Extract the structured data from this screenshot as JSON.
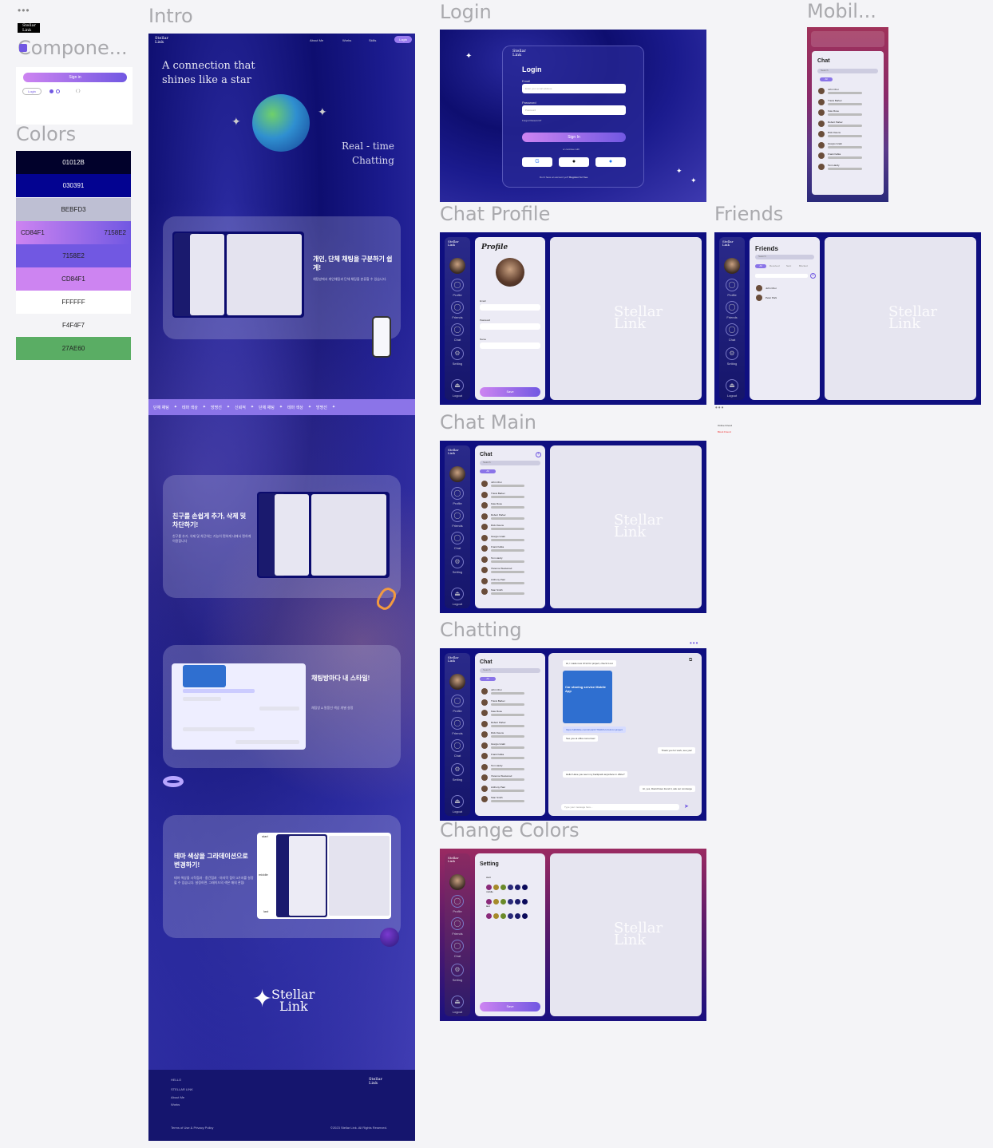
{
  "canvas": {
    "top_dots": "•••",
    "sections": {
      "components": "Compone...",
      "colors": "Colors",
      "intro": "Intro",
      "login": "Login",
      "mobile": "Mobil...",
      "chat_profile": "Chat Profile",
      "friends": "Friends",
      "chat_main": "Chat Main",
      "chatting": "Chatting",
      "change_colors": "Change Colors"
    }
  },
  "brand": {
    "line1": "Stellar",
    "line2": "Link"
  },
  "components": {
    "signin": "Sign in",
    "login_tag": "Login",
    "arrows": "〈 〉"
  },
  "colors": [
    {
      "hex": "01012B",
      "fg": "#ffffff",
      "bg": "#01012b"
    },
    {
      "hex": "030391",
      "fg": "#ffffff",
      "bg": "#030391"
    },
    {
      "hex": "BEBFD3",
      "fg": "#222222",
      "bg": "#bebfd3"
    },
    {
      "hex": "7158E2",
      "fg": "#222222",
      "bg": "#7158e2"
    },
    {
      "hex": "CD84F1",
      "fg": "#222222",
      "bg": "#cd84f1"
    },
    {
      "hex": "FFFFFF",
      "fg": "#222222",
      "bg": "#ffffff"
    },
    {
      "hex": "F4F4F7",
      "fg": "#222222",
      "bg": "#f4f4f7"
    },
    {
      "hex": "27AE60",
      "fg": "#222222",
      "bg": "#5aad64"
    }
  ],
  "gradient_swatch": {
    "left": "CD84F1",
    "right": "7158E2"
  },
  "intro": {
    "nav": [
      "About Me",
      "Works",
      "Skills"
    ],
    "nav_button": "Login",
    "headline1": "A connection that",
    "headline2": "shines like a star",
    "realtime1": "Real - time",
    "realtime2": "Chatting",
    "feat1_title": "개인, 단체 채팅을 구분하기 쉽게!",
    "feat1_desc": "채팅방에서 개인채팅과 단체 채팅을 분류할 수 있습니다.",
    "marquee": [
      "단체 채팅",
      "테마 색상",
      "방명선",
      "신뢰적",
      "단체 채팅",
      "테마 색상",
      "방명선"
    ],
    "feat2_title": "친구를 손쉽게 추가, 삭제 및 차단하기!",
    "feat2_desc": "친구를 추가, 삭제 및 차단하는 기능이 편하게 내에서 편하게 이용합니다",
    "feat3_title": "채팅방마다 내 스타일!",
    "feat3_desc": "채팅방 & 말풍선 색상 개별 설정",
    "feat4_title": "테마 색상을 그라데이션으로 변경하기!",
    "feat4_desc": "테마 색상을 시작점과 · 중간점과 · 마지막 점이 3가지를 설정할 수 있습니다. 설정하면, 그래이드의 색은 매의 관점!",
    "grad_labels": [
      "start",
      "middle",
      "last"
    ],
    "footer_links": [
      "HELLO",
      "STELLAR LINK",
      "About Me",
      "Works"
    ],
    "footer_terms": "Terms of Use & Privacy Policy",
    "footer_copy": "©2023 Stellar Link. All Rights Reserved."
  },
  "login": {
    "title": "Login",
    "email": "Email",
    "email_ph": "Enter your email address",
    "password": "Password",
    "password_ph": "Password",
    "forgot": "Forgot Password?",
    "signin": "Sign In",
    "or": "or continue with",
    "noacc": "Don't have an account yet?",
    "register": "Register for free"
  },
  "mobile": {
    "title": "Chat",
    "search": "Search",
    "tabs": [
      "All",
      "Team",
      "Friends"
    ]
  },
  "profile": {
    "title": "Profile",
    "fields": [
      "Email",
      "Password",
      "Name"
    ],
    "save": "Save"
  },
  "friends": {
    "title": "Friends",
    "search": "Search",
    "tabs": [
      "All",
      "Received",
      "Sent",
      "Blocked"
    ],
    "list": [
      "John Choi",
      "Peter Park"
    ],
    "legend1": "Online Friend",
    "legend2": "Block Friend"
  },
  "sidebar": [
    "Profile",
    "Friends",
    "Chat",
    "Setting",
    "Logout"
  ],
  "chat": {
    "title": "Chat",
    "search": "Search",
    "tabs": [
      "All",
      "Team",
      "Friends"
    ],
    "names": [
      "John Choi",
      "Travis Barker",
      "Kate Rose",
      "Robert Parker",
      "Rick Owens",
      "Giorgio Gratti",
      "Frank Kafka",
      "Tom Hardy",
      "Vivienne Westwood",
      "Anthony Paul",
      "Stan Smith"
    ],
    "msg_top": "Hi, I made new UI kit for project, check it out",
    "msg_app": "Car sharing service Mobile App",
    "msg_link": "https://dribbble.com/shots/17763216-UI-kit-for-project",
    "msg_see": "See you at office tomorrow!",
    "msg_thanks": "Thank you for work, see you!",
    "msg_q": "Hello! Have you seen my backpack anywhere in office?",
    "msg_a": "Hi, yes, David have found it, ask our concierge",
    "placeholder": "Type your message here..."
  },
  "settings": {
    "title": "Setting",
    "labels": [
      "start",
      "middle",
      "last"
    ],
    "save": "Save"
  }
}
